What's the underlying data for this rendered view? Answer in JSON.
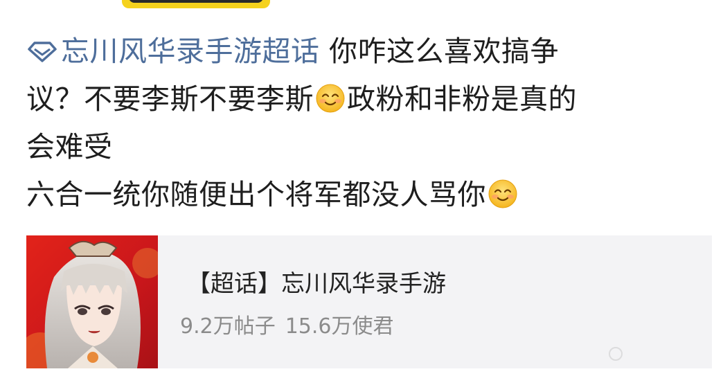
{
  "post": {
    "topic": "忘川风华录手游超话",
    "text_part1": " 你咋这么喜欢搞争",
    "line2_a": "议？不要李斯不要李斯",
    "line2_b": "政粉和非粉是真的",
    "line3": "会难受",
    "line4": "六合一统你随便出个将军都没人骂你"
  },
  "card": {
    "title": "【超话】忘川风华录手游",
    "posts": "9.2万帖子",
    "members": "15.6万使君"
  },
  "icons": {
    "topic": "diamond-icon",
    "emoji": "smile-emoji-icon"
  },
  "colors": {
    "topic_link": "#4e6e9b",
    "card_bg": "#f3f3f5"
  }
}
